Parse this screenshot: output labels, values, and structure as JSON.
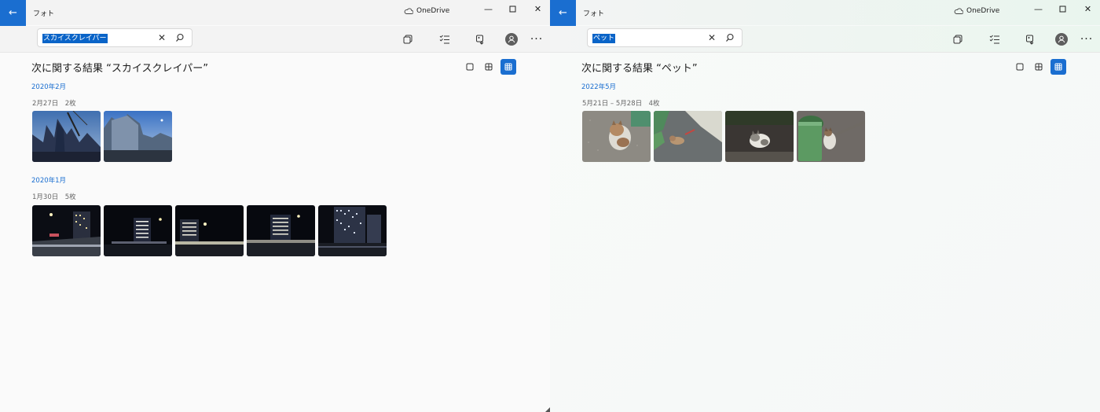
{
  "windows": [
    {
      "app_title": "フォト",
      "onedrive_label": "OneDrive",
      "search": {
        "value": "スカイスクレイパー"
      },
      "results_heading": "次に関する結果 “スカイスクレイパー”",
      "groups": [
        {
          "month": "2020年2月",
          "subtitle": "2月27日　2枚",
          "photo_count": 2
        },
        {
          "month": "2020年1月",
          "subtitle": "1月30日　5枚",
          "photo_count": 5
        }
      ]
    },
    {
      "app_title": "フォト",
      "onedrive_label": "OneDrive",
      "search": {
        "value": "ペット"
      },
      "results_heading": "次に関する結果 “ペット”",
      "groups": [
        {
          "month": "2022年5月",
          "subtitle": "5月21日 – 5月28日　4枚",
          "photo_count": 4
        }
      ]
    }
  ],
  "icons": {
    "back": "back-arrow-icon",
    "cloud": "onedrive-cloud-icon",
    "minimize": "minimize-icon",
    "maximize": "maximize-icon",
    "close": "close-icon",
    "search_clear": "clear-icon",
    "search": "search-icon",
    "toolbar": [
      "slideshow-icon",
      "select-icon",
      "import-icon",
      "account-icon",
      "more-icon"
    ],
    "views": [
      "single-view-icon",
      "grid-view-icon",
      "dense-grid-view-icon"
    ]
  },
  "colors": {
    "accent": "#1a6ed0",
    "selection": "#0a64c8",
    "month_link": "#1a6ed0"
  }
}
